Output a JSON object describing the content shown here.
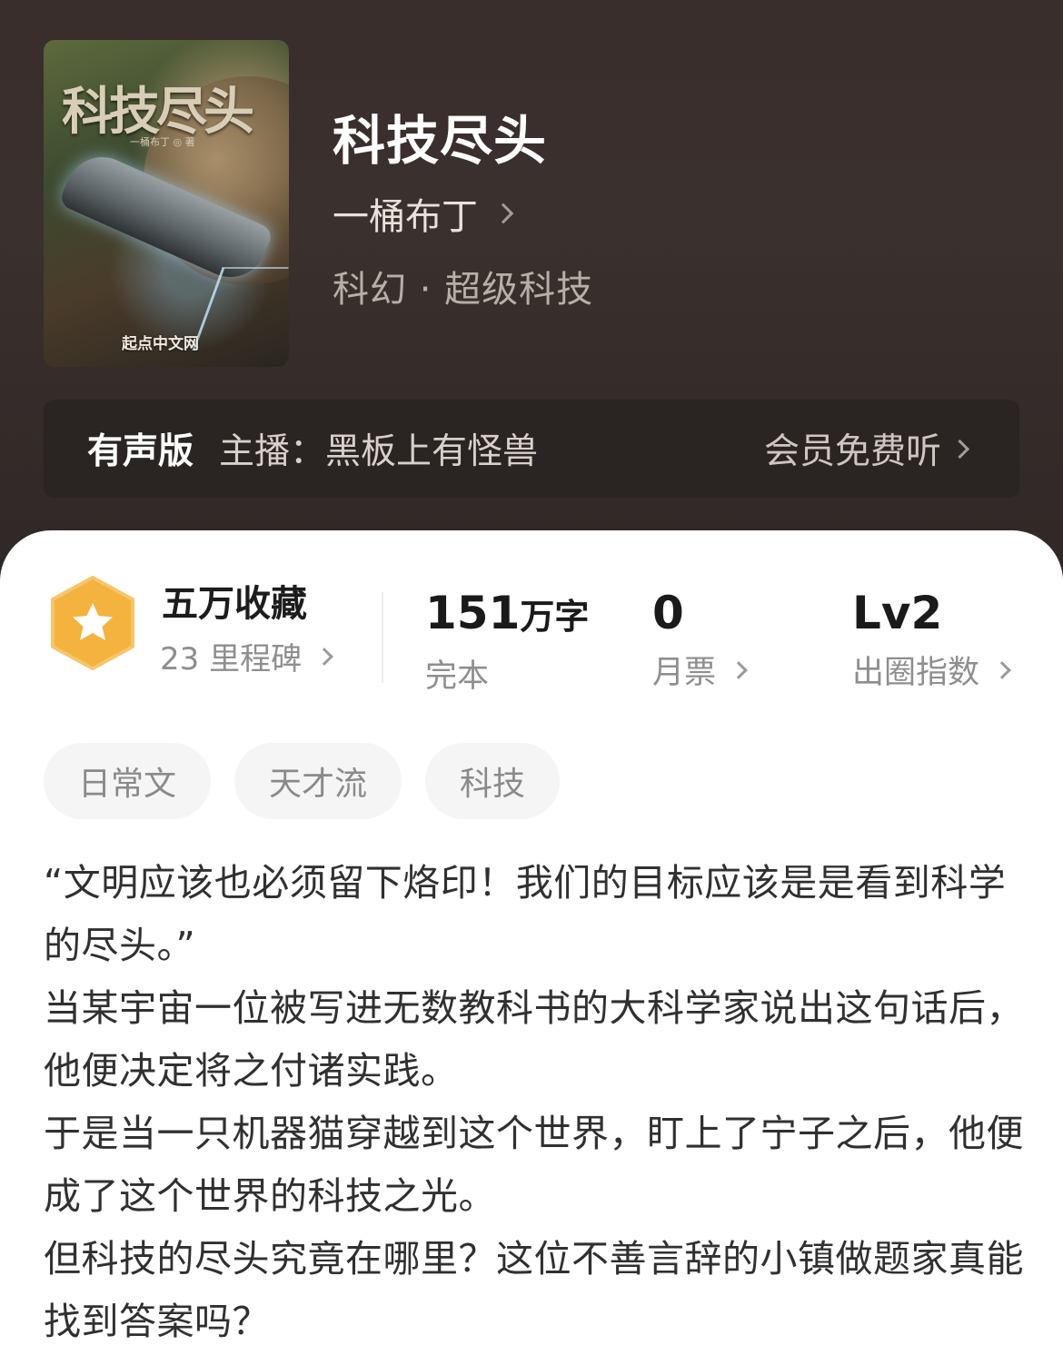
{
  "book": {
    "cover_title": "科技尽头",
    "cover_author": "一桶布丁 ◎ 著",
    "cover_publisher": "起点中文网",
    "title": "科技尽头",
    "author": "一桶布丁",
    "genre": "科幻 · 超级科技"
  },
  "audio": {
    "label": "有声版",
    "narrator": "主播：黑板上有怪兽",
    "action": "会员免费听"
  },
  "milestone": {
    "title": "五万收藏",
    "subtitle": "23 里程碑"
  },
  "stats": {
    "words_value": "151",
    "words_unit": "万字",
    "words_label": "完本",
    "votes_value": "0",
    "votes_label": "月票",
    "level_value": "Lv2",
    "level_label": "出圈指数"
  },
  "tags": [
    "日常文",
    "天才流",
    "科技"
  ],
  "intro": [
    "“文明应该也必须留下烙印！我们的目标应该是是看到科学的尽头。”",
    "当某宇宙一位被写进无数教科书的大科学家说出这句话后，他便决定将之付诸实践。",
    "于是当一只机器猫穿越到这个世界，盯上了宁子之后，他便成了这个世界的科技之光。",
    "但科技的尽头究竟在哪里？这位不善言辞的小镇做题家真能找到答案吗？"
  ],
  "colors": {
    "header_bg": "#3a2e2c",
    "badge_orange": "#f4b23e",
    "text_dark": "#1c1c1c",
    "text_muted": "#8e8e8e"
  },
  "icons": [
    "chevron-right-icon",
    "star-badge-icon"
  ]
}
